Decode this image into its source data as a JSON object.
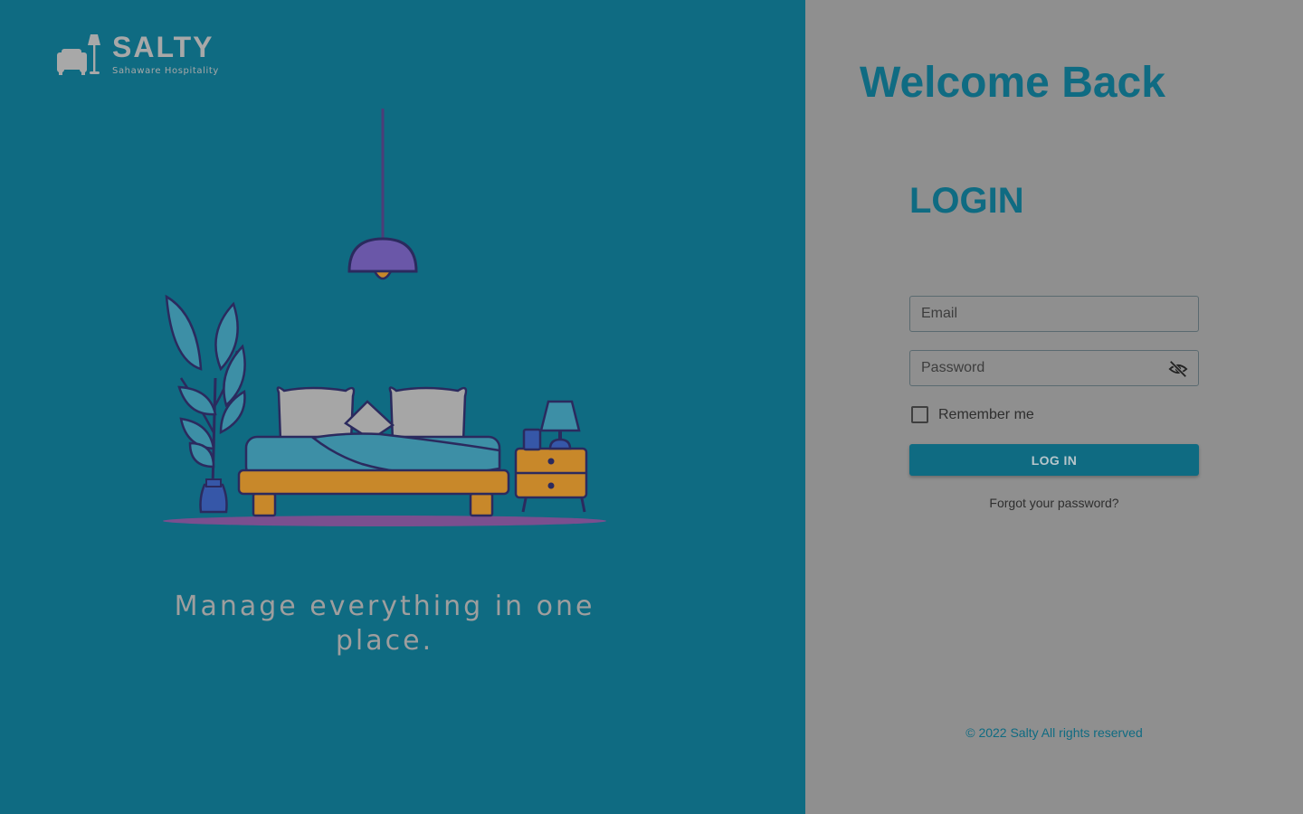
{
  "brand": {
    "name": "SALTY",
    "subtitle": "Sahaware Hospitality",
    "logo_icon": "armchair-lamp-icon"
  },
  "hero": {
    "tagline": "Manage everything in one place.",
    "illustration": "bedroom-illustration"
  },
  "login": {
    "welcome": "Welcome Back",
    "title": "LOGIN",
    "email_placeholder": "Email",
    "email_value": "",
    "password_placeholder": "Password",
    "password_value": "",
    "password_toggle_icon": "eye-off-icon",
    "remember_label": "Remember me",
    "remember_checked": false,
    "submit_label": "LOG IN",
    "forgot_label": "Forgot your password?"
  },
  "footer": {
    "copyright": "© 2022 Salty All rights reserved"
  },
  "colors": {
    "primary": "#0f6b82",
    "panel_bg": "#8f8f8f"
  }
}
